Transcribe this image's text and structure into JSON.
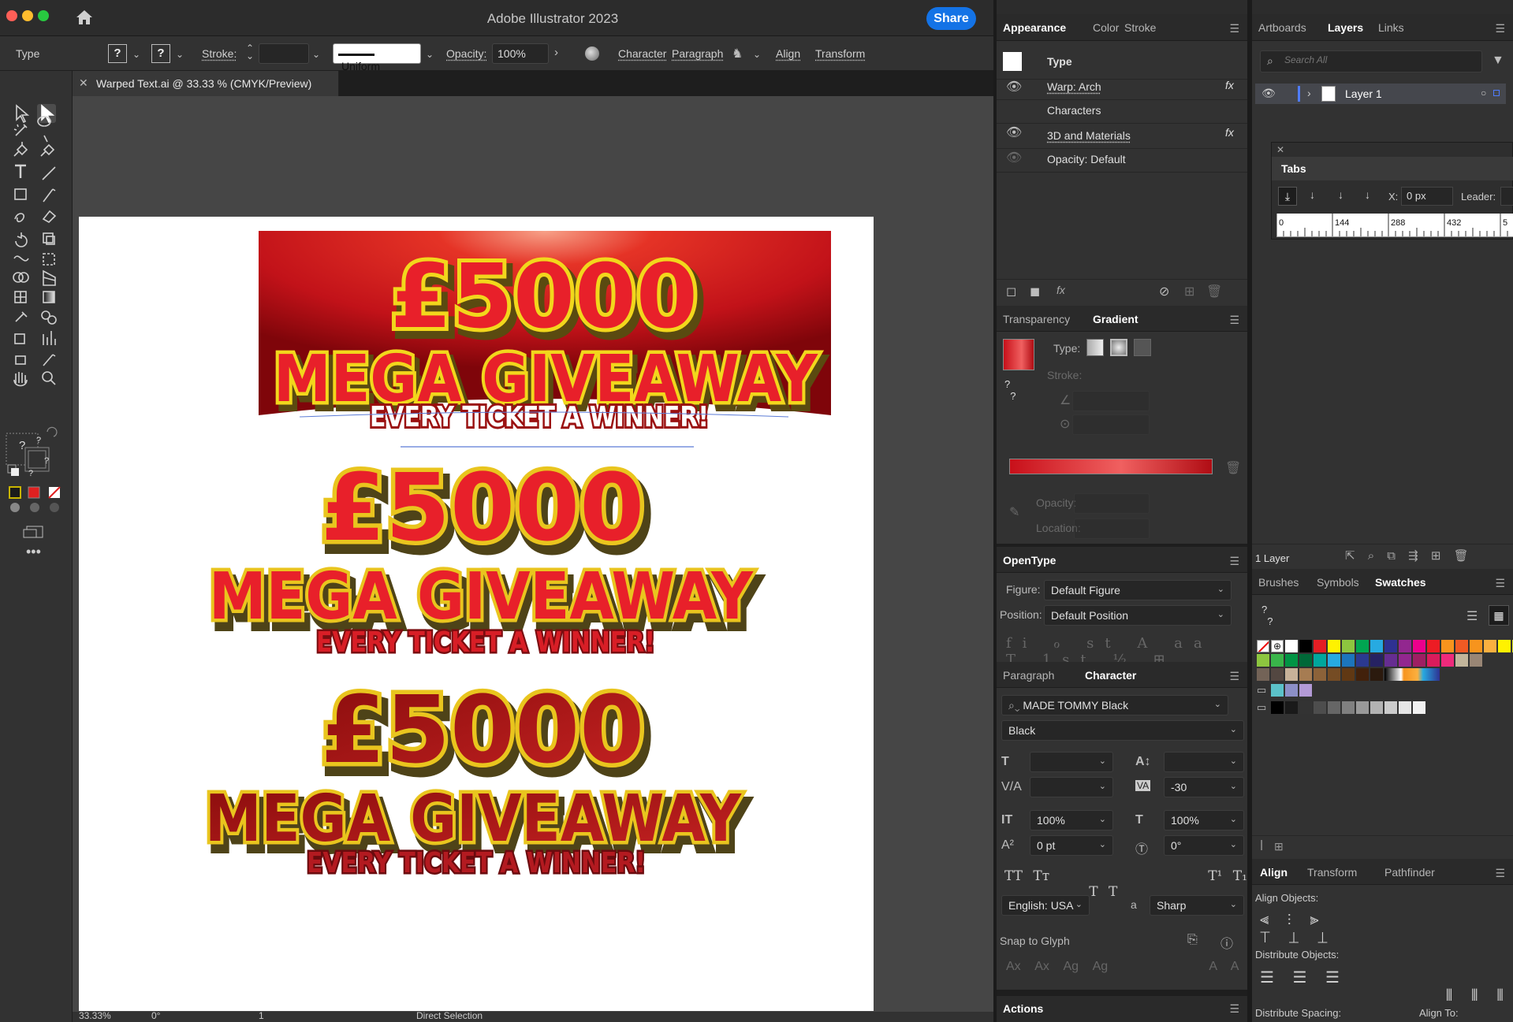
{
  "app": {
    "title": "Adobe Illustrator 2023",
    "share_label": "Share"
  },
  "control": {
    "mode": "Type",
    "stroke_label": "Stroke:",
    "stroke_style": "Uniform",
    "opacity_label": "Opacity:",
    "opacity_value": "100%",
    "character_link": "Character",
    "paragraph_link": "Paragraph",
    "align_link": "Align",
    "transform_link": "Transform",
    "unknown": "?"
  },
  "document": {
    "tab_title": "Warped Text.ai @ 33.33 % (CMYK/Preview)",
    "zoom": "33.33%",
    "rotation": "0°",
    "artboard_num": "1",
    "status": "Direct Selection"
  },
  "artwork": {
    "line1": "£5000",
    "line2": "MEGA GIVEAWAY",
    "line3": "EVERY TICKET A WINNER!"
  },
  "appearance": {
    "tabs": [
      "Appearance",
      "Color",
      "Stroke"
    ],
    "object_type": "Type",
    "items": [
      "Warp: Arch",
      "Characters",
      "3D and Materials",
      "Opacity: Default"
    ],
    "fx": "fx"
  },
  "gradient": {
    "tabs": [
      "Transparency",
      "Gradient"
    ],
    "type_label": "Type:",
    "stroke_label": "Stroke:",
    "opacity_label": "Opacity:",
    "location_label": "Location:",
    "stops": [
      "#c8101a",
      "#f06060",
      "#b00d14"
    ]
  },
  "opentype": {
    "title": "OpenType",
    "figure_label": "Figure:",
    "figure_value": "Default Figure",
    "position_label": "Position:",
    "position_value": "Default Position"
  },
  "character": {
    "tabs": [
      "Paragraph",
      "Character"
    ],
    "font": "MADE TOMMY Black",
    "style": "Black",
    "tracking": "-30",
    "vscale": "100%",
    "hscale": "100%",
    "baseline": "0 pt",
    "rotation": "0°",
    "language": "English: USA",
    "aa_label": "a",
    "antialias": "Sharp",
    "snap_label": "Snap to Glyph"
  },
  "actions": {
    "title": "Actions"
  },
  "layers": {
    "tabs": [
      "Artboards",
      "Layers",
      "Links"
    ],
    "search_placeholder": "Search All",
    "layer_name": "Layer 1",
    "count": "1 Layer"
  },
  "tabs_panel": {
    "title": "Tabs",
    "x_label": "X:",
    "x_value": "0 px",
    "leader_label": "Leader:",
    "ruler": [
      "0",
      "144",
      "288",
      "432",
      "5"
    ]
  },
  "swatches": {
    "tabs": [
      "Brushes",
      "Symbols",
      "Swatches"
    ],
    "row1": [
      "#ffffff",
      "#000000",
      "#e31e24",
      "#fff200",
      "#8dc63f",
      "#00a651",
      "#27aae1",
      "#2e3192",
      "#92278f",
      "#ec008c",
      "#ed1c24",
      "#f7941d",
      "#f15a24",
      "#f7941d",
      "#fbb040",
      "#fff200",
      "#d7df23"
    ],
    "row2": [
      "#8dc63f",
      "#39b54a",
      "#009444",
      "#006838",
      "#00a79d",
      "#27aae1",
      "#1c75bc",
      "#2b3990",
      "#262262",
      "#662d91",
      "#92278f",
      "#9e1f63",
      "#da1c5c",
      "#ee2a7b",
      "#c2b59b",
      "#998675"
    ],
    "row3": [
      "#736357",
      "#534741",
      "#c7b299",
      "#a67c52",
      "#8c6239",
      "#754c24",
      "#603813",
      "#42210b",
      "#2b1a0e"
    ],
    "row4": [
      "#5bc2c9",
      "#8c8fc7",
      "#b39ad6"
    ],
    "row5": [
      "#000000",
      "#1a1a1a",
      "#333333",
      "#4d4d4d",
      "#666666",
      "#808080",
      "#999999",
      "#b3b3b3",
      "#cccccc",
      "#e6e6e6",
      "#f2f2f2"
    ]
  },
  "align": {
    "tabs": [
      "Align",
      "Transform",
      "Pathfinder"
    ],
    "align_objects": "Align Objects:",
    "distribute_objects": "Distribute Objects:",
    "distribute_spacing": "Distribute Spacing:",
    "align_to": "Align To:"
  }
}
